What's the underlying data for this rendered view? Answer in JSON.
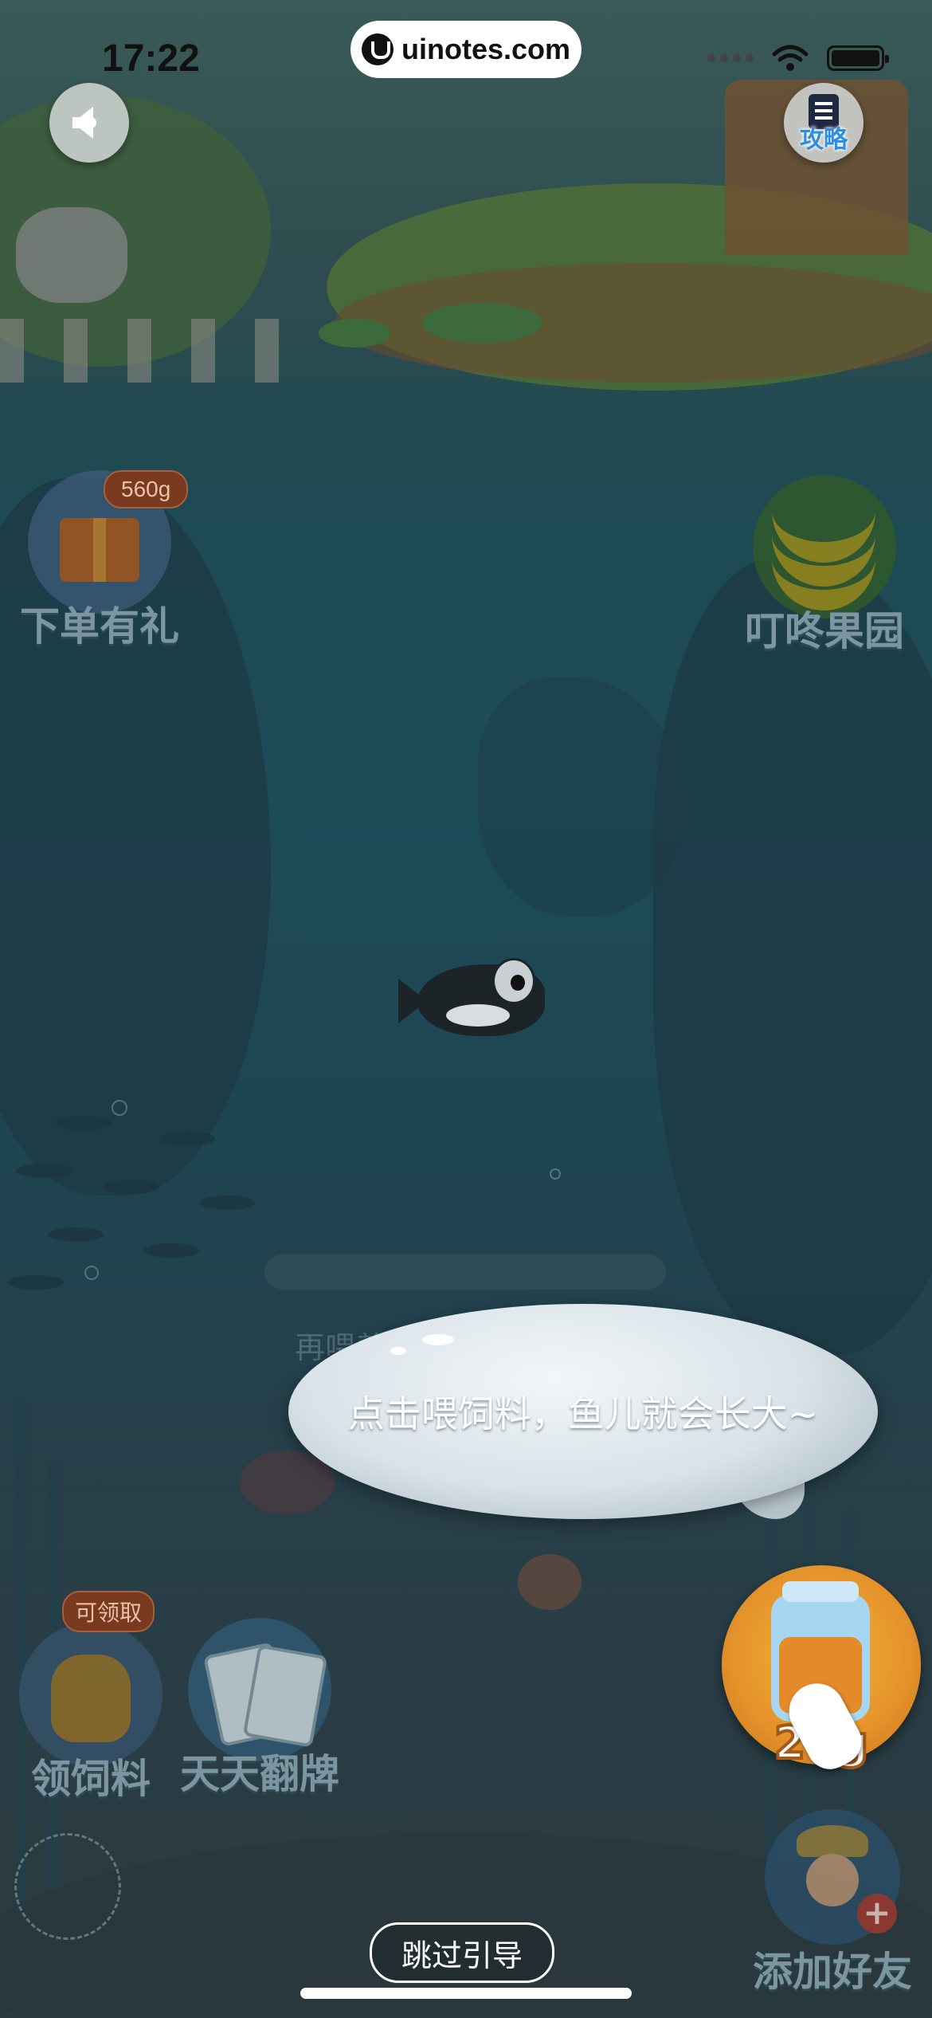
{
  "status_bar": {
    "time": "17:22"
  },
  "watermark": {
    "text": "uinotes.com"
  },
  "top_bar": {
    "guide_label": "攻略"
  },
  "features": {
    "order_gift": {
      "label": "下单有礼",
      "badge": "560g"
    },
    "dingdong_orchard": {
      "label": "叮咚果园"
    },
    "get_feed": {
      "label": "领饲料",
      "badge": "可领取"
    },
    "daily_flip": {
      "label": "天天翻牌"
    },
    "add_friend": {
      "label": "添加好友"
    }
  },
  "fish": {
    "progress": 0.0,
    "tip": "再喂养1次，就长成稚鱼啦"
  },
  "tutorial": {
    "bubble_text": "点击喂饲料，鱼儿就会长大~",
    "skip_label": "跳过引导"
  },
  "feed_button": {
    "amount": "20g"
  },
  "colors": {
    "water": "#1d4b58",
    "accent_orange": "#e4922a",
    "badge_brown": "#7a3a20"
  }
}
